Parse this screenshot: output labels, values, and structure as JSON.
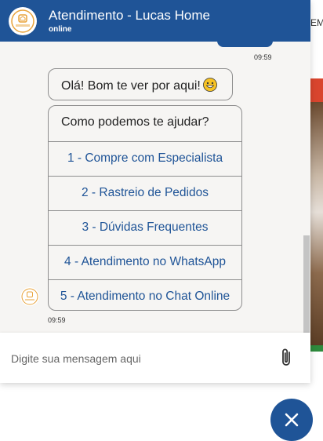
{
  "header": {
    "title": "Atendimento - Lucas Home",
    "status": "online",
    "logo_icon": "lucas-home-logo-icon"
  },
  "background": {
    "fragment_text": "EM]"
  },
  "messages": {
    "user_time": "09:59",
    "greeting": "Olá! Bom te ver por aqui!",
    "greeting_emoji": "grinning-face-icon",
    "question": "Como podemos te ajudar?",
    "options": [
      "1 - Compre com Especialista",
      "2 - Rastreio de Pedidos",
      "3 - Dúvidas Frequentes",
      "4 - Atendimento no WhatsApp",
      "5 - Atendimento no Chat Online"
    ],
    "bot_time": "09:59"
  },
  "input": {
    "placeholder": "Digite sua mensagem aqui"
  },
  "colors": {
    "brand": "#1f5497",
    "link": "#1f5497",
    "panel_bg": "#f6f5f3"
  }
}
